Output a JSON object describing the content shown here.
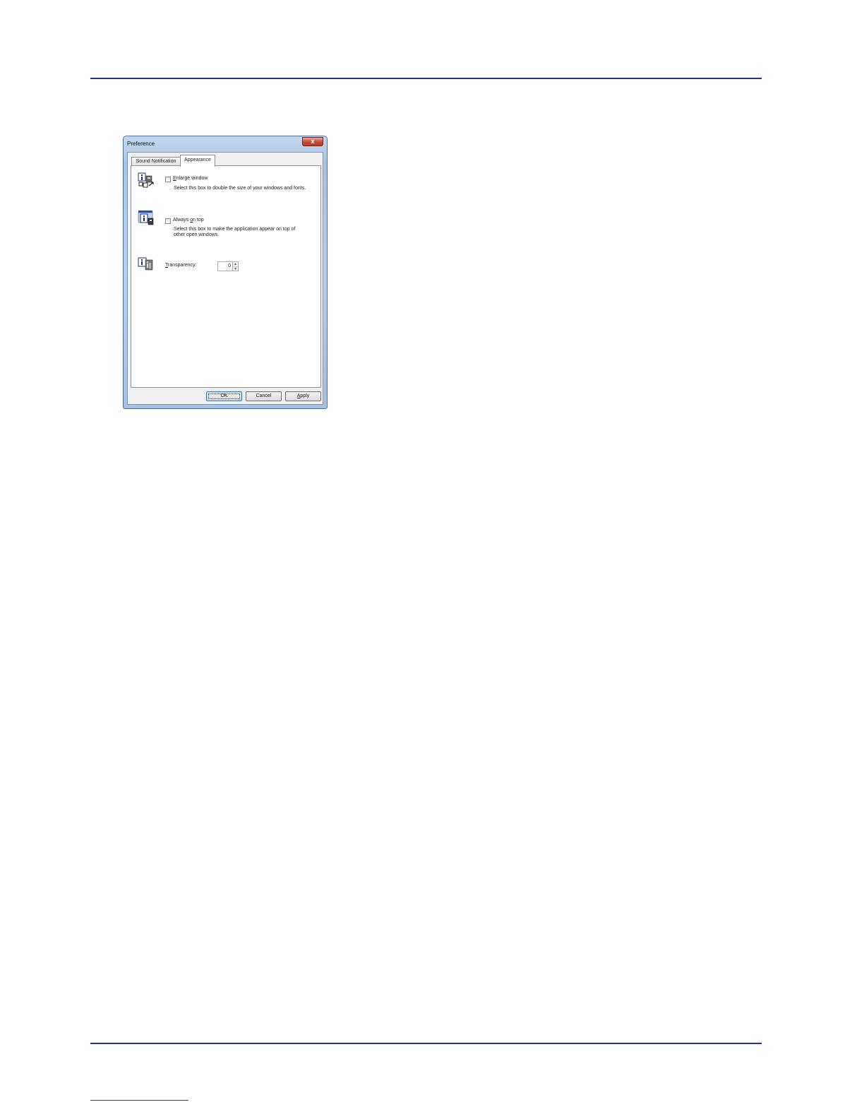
{
  "dialog": {
    "title": "Preference",
    "close_glyph": "x",
    "tabs": [
      {
        "label": "Sound Notification",
        "selected": false
      },
      {
        "label": "Appearance",
        "selected": true
      }
    ],
    "options": {
      "enlarge": {
        "label_first": "E",
        "label_rest": "nlarge window",
        "checked": false,
        "description": "Select this box to double the size of your windows and fonts."
      },
      "on_top": {
        "label_pre": "Always ",
        "label_u": "o",
        "label_post": "n top",
        "checked": false,
        "description": "Select this box to make the application appear on top of other open windows."
      },
      "transparency": {
        "label_first": "T",
        "label_rest": "ransparency:",
        "value": "0",
        "up_glyph": "▲",
        "down_glyph": "▼"
      }
    },
    "buttons": {
      "ok": "OK",
      "cancel": "Cancel",
      "apply_first": "A",
      "apply_rest": "pply"
    },
    "icons": {
      "enlarge": "enlarge-window-icon",
      "on_top": "always-on-top-icon",
      "transparency": "transparency-icon"
    }
  },
  "colors": {
    "rule": "#23318f",
    "title_gradient": "#b9cfe9",
    "close_button": "#c94a36"
  }
}
